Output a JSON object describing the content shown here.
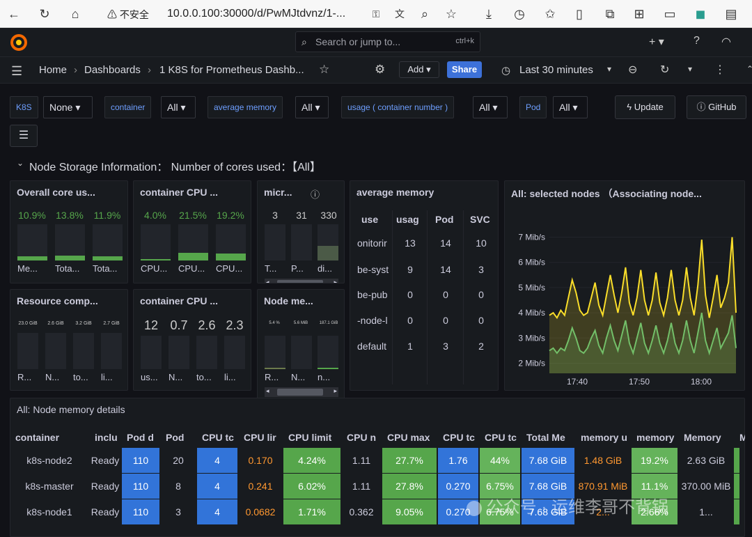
{
  "browser": {
    "security": "不安全",
    "url": "10.0.0.100:30000/d/PwMJtdvnz/1-..."
  },
  "topbar": {
    "search_placeholder": "Search or jump to...",
    "search_shortcut": "ctrl+k"
  },
  "breadcrumb": {
    "home": "Home",
    "dashboards": "Dashboards",
    "current": "1 K8S for Prometheus Dashb..."
  },
  "toolbar": {
    "add": "Add",
    "share": "Share",
    "time_range": "Last 30 minutes",
    "update": "Update",
    "github": "GitHub"
  },
  "variables": [
    {
      "label": "K8S",
      "value": "None"
    },
    {
      "label": "container",
      "value": "All"
    },
    {
      "label": "average memory",
      "value": "All"
    },
    {
      "label": "usage ( container number )",
      "value": "All"
    },
    {
      "label": "Pod",
      "value": "All"
    }
  ],
  "row_title": "Node Storage Information：  Number of cores used：【All】",
  "panels": {
    "overall": {
      "title": "Overall core us...",
      "values": [
        "10.9%",
        "13.8%",
        "11.9%"
      ],
      "labels": [
        "Me...",
        "Tota...",
        "Tota..."
      ],
      "fills": [
        0.12,
        0.14,
        0.12
      ]
    },
    "container_cpu_1": {
      "title": "container CPU ...",
      "values": [
        "4.0%",
        "21.5%",
        "19.2%"
      ],
      "labels": [
        "CPU...",
        "CPU...",
        "CPU..."
      ],
      "fills": [
        0.04,
        0.22,
        0.19
      ]
    },
    "micro": {
      "title": "micr...",
      "values": [
        "3",
        "31",
        "330"
      ],
      "labels": [
        "T...",
        "P...",
        "di..."
      ],
      "fills": [
        0.0,
        0.0,
        0.4
      ]
    },
    "resource": {
      "title": "Resource comp...",
      "values": [
        "23.0 GiB",
        "2.6 GiB",
        "3.2 GiB",
        "2.7 GiB"
      ],
      "labels": [
        "R...",
        "N...",
        "to...",
        "li..."
      ]
    },
    "container_cpu_2": {
      "title": "container CPU ...",
      "values": [
        "12",
        "0.7",
        "2.6",
        "2.3"
      ],
      "labels": [
        "us...",
        "N...",
        "to...",
        "li..."
      ]
    },
    "node_me": {
      "title": "Node me...",
      "values": [
        "5.4 %",
        "5.6 MiB",
        "187.1 GiB"
      ],
      "labels": [
        "R...",
        "N...",
        "n..."
      ]
    },
    "average_memory": {
      "title": "average memory",
      "columns": [
        "use",
        "usag",
        "Pod",
        "SVC"
      ],
      "rows": [
        [
          "onitorir",
          "13",
          "14",
          "10"
        ],
        [
          "be-syst",
          "9",
          "14",
          "3"
        ],
        [
          "be-pub",
          "0",
          "0",
          "0"
        ],
        [
          "-node-l",
          "0",
          "0",
          "0"
        ],
        [
          "default",
          "1",
          "3",
          "2"
        ]
      ]
    },
    "selected_nodes": {
      "title": "All:   selected nodes  （Associating node..."
    }
  },
  "chart_data": {
    "type": "line",
    "title": "All:   selected nodes  （Associating node...",
    "y_ticks": [
      "7 Mib/s",
      "6 Mib/s",
      "5 Mib/s",
      "4 Mib/s",
      "3 Mib/s",
      "2 Mib/s"
    ],
    "x_ticks": [
      "17:40",
      "17:50",
      "18:00"
    ],
    "ylim": [
      1.6,
      7.4
    ],
    "series": [
      {
        "color": "#fade2a",
        "values": [
          3.9,
          4.0,
          3.8,
          4.1,
          3.9,
          4.6,
          5.3,
          4.8,
          4.1,
          3.9,
          4.0,
          4.6,
          5.2,
          4.3,
          3.9,
          4.7,
          5.5,
          4.7,
          4.0,
          4.8,
          5.8,
          4.4,
          3.9,
          4.6,
          5.7,
          4.5,
          3.9,
          4.5,
          5.6,
          4.4,
          3.9,
          4.6,
          5.7,
          4.5,
          3.9,
          4.5,
          5.8,
          4.6,
          3.9,
          5.1,
          6.9,
          4.7,
          3.8,
          4.6,
          5.5,
          4.2,
          4.6,
          5.2,
          7.0,
          4.0
        ]
      },
      {
        "color": "#73bf69",
        "values": [
          2.5,
          2.6,
          2.4,
          2.6,
          2.5,
          2.9,
          3.4,
          3.0,
          2.5,
          2.4,
          2.6,
          3.0,
          3.3,
          2.7,
          2.4,
          3.0,
          3.5,
          2.9,
          2.5,
          3.1,
          3.7,
          2.8,
          2.4,
          3.0,
          3.6,
          2.8,
          2.4,
          2.9,
          3.5,
          2.8,
          2.4,
          2.9,
          3.6,
          2.8,
          2.4,
          2.9,
          3.7,
          2.9,
          2.4,
          3.2,
          4.0,
          2.9,
          2.4,
          2.9,
          3.4,
          2.6,
          2.9,
          3.2,
          3.9,
          2.6
        ]
      }
    ]
  },
  "node_table": {
    "title": "All:   Node memory details",
    "columns": [
      "container",
      "inclu",
      "Pod d",
      "Pod",
      "CPU tc",
      "CPU lir",
      "CPU limit",
      "CPU n",
      "CPU max",
      "CPU tc",
      "CPU tc",
      "Total Me",
      "memory u",
      "memory",
      "Memory",
      "M"
    ],
    "rows": [
      [
        "k8s-node2",
        "Ready",
        "110",
        "20",
        "4",
        "0.170",
        "4.24%",
        "1.11",
        "27.7%",
        "1.76",
        "44%",
        "7.68 GiB",
        "1.48 GiB",
        "19.2%",
        "2.63 GiB"
      ],
      [
        "k8s-master",
        "Ready",
        "110",
        "8",
        "4",
        "0.241",
        "6.02%",
        "1.11",
        "27.8%",
        "0.270",
        "6.75%",
        "7.68 GiB",
        "870.91 MiB",
        "11.1%",
        "370.00 MiB"
      ],
      [
        "k8s-node1",
        "Ready",
        "110",
        "3",
        "4",
        "0.0682",
        "1.71%",
        "0.362",
        "9.05%",
        "0.270",
        "6.75%",
        "7.68 GiB",
        "2...",
        "2.66%",
        "1..."
      ]
    ]
  },
  "watermark": "公众号 · 运维李哥不背锅"
}
